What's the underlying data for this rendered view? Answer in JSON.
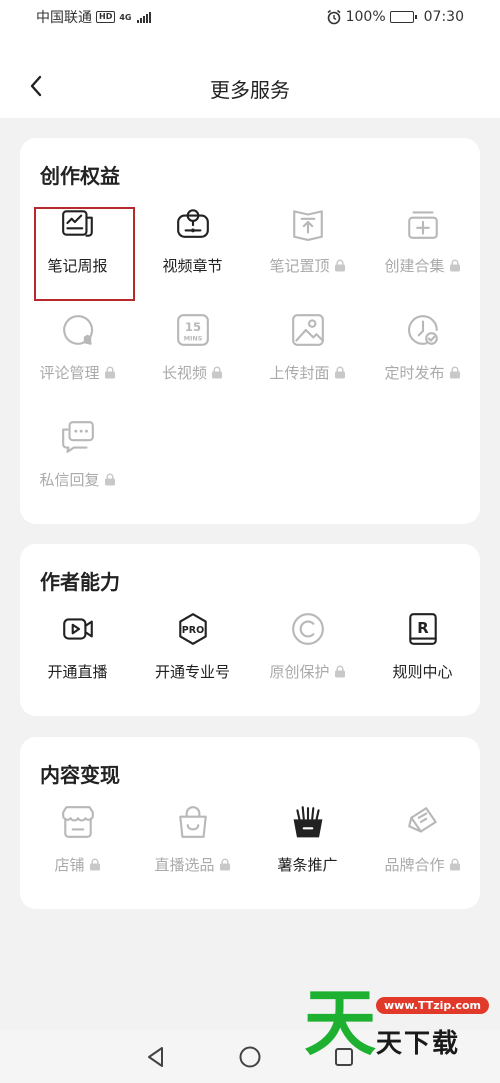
{
  "status": {
    "carrier": "中国联通",
    "hd": "HD",
    "network": "4G",
    "battery": "100%",
    "time": "07:30"
  },
  "header": {
    "title": "更多服务"
  },
  "sections": [
    {
      "title": "创作权益",
      "items": [
        {
          "label": "笔记周报",
          "icon": "weekly-report-icon",
          "locked": false
        },
        {
          "label": "视频章节",
          "icon": "video-chapter-icon",
          "locked": false
        },
        {
          "label": "笔记置顶",
          "icon": "pin-top-icon",
          "locked": true
        },
        {
          "label": "创建合集",
          "icon": "create-collection-icon",
          "locked": true
        },
        {
          "label": "评论管理",
          "icon": "comment-manage-icon",
          "locked": true
        },
        {
          "label": "长视频",
          "icon": "long-video-icon",
          "locked": true
        },
        {
          "label": "上传封面",
          "icon": "upload-cover-icon",
          "locked": true
        },
        {
          "label": "定时发布",
          "icon": "scheduled-publish-icon",
          "locked": true
        },
        {
          "label": "私信回复",
          "icon": "message-reply-icon",
          "locked": true
        }
      ]
    },
    {
      "title": "作者能力",
      "items": [
        {
          "label": "开通直播",
          "icon": "live-stream-icon",
          "locked": false
        },
        {
          "label": "开通专业号",
          "icon": "pro-account-icon",
          "locked": false
        },
        {
          "label": "原创保护",
          "icon": "copyright-icon",
          "locked": true
        },
        {
          "label": "规则中心",
          "icon": "rules-center-icon",
          "locked": false
        }
      ]
    },
    {
      "title": "内容变现",
      "items": [
        {
          "label": "店铺",
          "icon": "store-icon",
          "locked": true
        },
        {
          "label": "直播选品",
          "icon": "shopping-bag-icon",
          "locked": true
        },
        {
          "label": "薯条推广",
          "icon": "fries-promo-icon",
          "locked": false
        },
        {
          "label": "品牌合作",
          "icon": "brand-coop-icon",
          "locked": true
        }
      ]
    }
  ],
  "watermark": {
    "big": "天",
    "url": "www.TTzip.com",
    "text": "天下载"
  },
  "colors": {
    "highlight": "#b8292e",
    "enabled": "#222222",
    "disabled": "#aaaaaa"
  }
}
